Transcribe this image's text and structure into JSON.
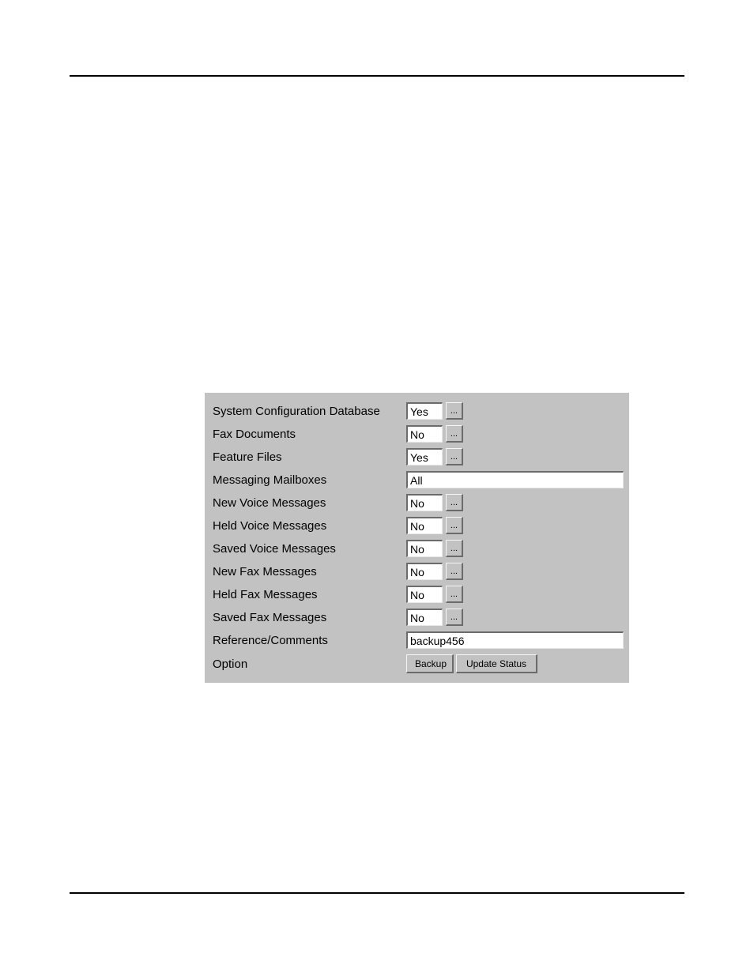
{
  "form": {
    "rows": [
      {
        "label": "System Configuration Database",
        "value": "Yes",
        "type": "short"
      },
      {
        "label": "Fax Documents",
        "value": "No",
        "type": "short"
      },
      {
        "label": "Feature Files",
        "value": "Yes",
        "type": "short"
      },
      {
        "label": "Messaging Mailboxes",
        "value": "All",
        "type": "long"
      },
      {
        "label": "New Voice Messages",
        "value": "No",
        "type": "short"
      },
      {
        "label": "Held Voice Messages",
        "value": "No",
        "type": "short"
      },
      {
        "label": "Saved Voice Messages",
        "value": "No",
        "type": "short"
      },
      {
        "label": "New Fax Messages",
        "value": "No",
        "type": "short"
      },
      {
        "label": "Held Fax Messages",
        "value": "No",
        "type": "short"
      },
      {
        "label": "Saved Fax Messages",
        "value": "No",
        "type": "short"
      },
      {
        "label": "Reference/Comments",
        "value": "backup456",
        "type": "long"
      }
    ],
    "option_label": "Option",
    "ellipsis_label": "...",
    "buttons": {
      "backup": "Backup",
      "update_status": "Update Status"
    }
  }
}
